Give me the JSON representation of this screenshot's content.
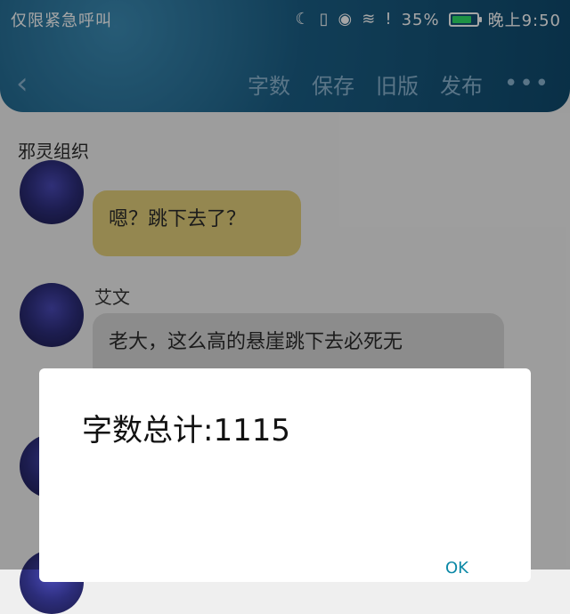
{
  "status_bar": {
    "carrier_text": "仅限紧急呼叫",
    "battery_percent": "35%",
    "time": "晚上9:50",
    "icons": [
      "moon-icon",
      "vibrate-icon",
      "eye-icon",
      "wifi-icon",
      "alert-icon",
      "battery-icon"
    ]
  },
  "header": {
    "actions": [
      "字数",
      "保存",
      "旧版",
      "发布"
    ],
    "more": "•••"
  },
  "chat": {
    "section_title": "邪灵组织",
    "messages": [
      {
        "text": "嗯？跳下去了？"
      },
      {
        "sender_name": "艾文",
        "text": "老大，这么高的悬崖跳下去必死无"
      }
    ]
  },
  "dialog": {
    "message": "字数总计:1115",
    "ok_label": "OK"
  },
  "colors": {
    "header_blue": "#1b5f86",
    "yellow_bubble": "#e4d07b",
    "gray_bubble": "#d8d8d8",
    "ok_teal": "#0b88a6"
  }
}
